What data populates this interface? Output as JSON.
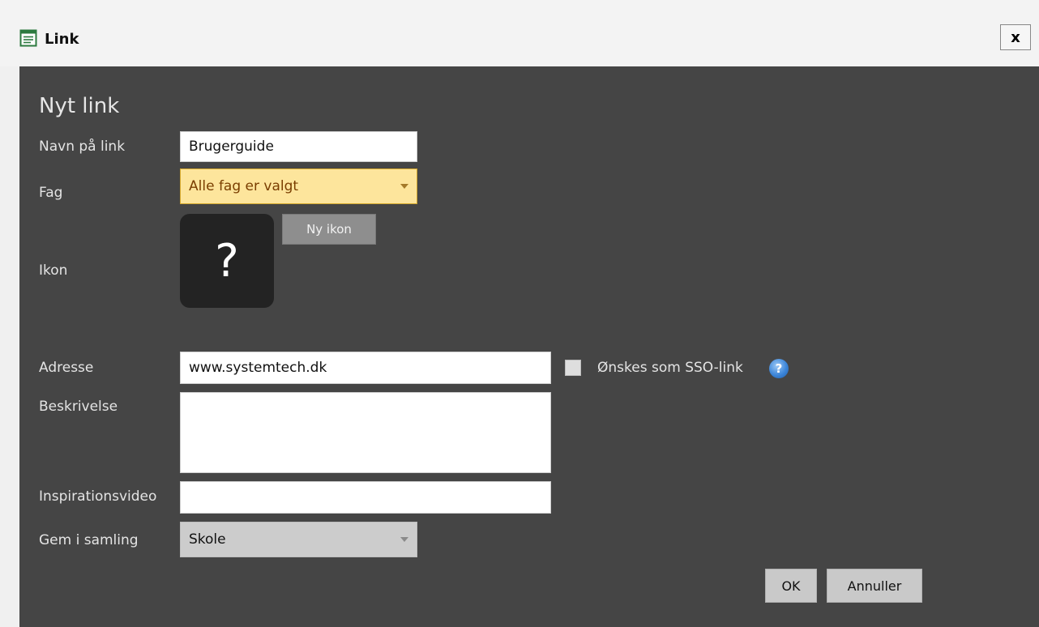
{
  "window": {
    "title": "Link",
    "close_label": "x"
  },
  "form": {
    "heading": "Nyt link",
    "name": {
      "label": "Navn på link",
      "value": "Brugerguide"
    },
    "subject": {
      "label": "Fag",
      "value": "Alle fag er valgt"
    },
    "icon": {
      "label": "Ikon",
      "glyph": "?",
      "new_icon_label": "Ny ikon"
    },
    "address": {
      "label": "Adresse",
      "value": "www.systemtech.dk"
    },
    "sso": {
      "label": "Ønskes som SSO-link",
      "checked": false,
      "help_glyph": "?"
    },
    "description": {
      "label": "Beskrivelse",
      "value": ""
    },
    "video": {
      "label": "Inspirationsvideo",
      "value": ""
    },
    "collection": {
      "label": "Gem i samling",
      "value": "Skole"
    }
  },
  "buttons": {
    "ok_label": "OK",
    "cancel_label": "Annuller"
  },
  "icons": {
    "title_icon": "document-list-icon",
    "help_icon": "help-icon"
  },
  "colors": {
    "panel_bg": "#454545",
    "highlight_select": "#fde59c",
    "help_blue": "#3d86d9"
  }
}
